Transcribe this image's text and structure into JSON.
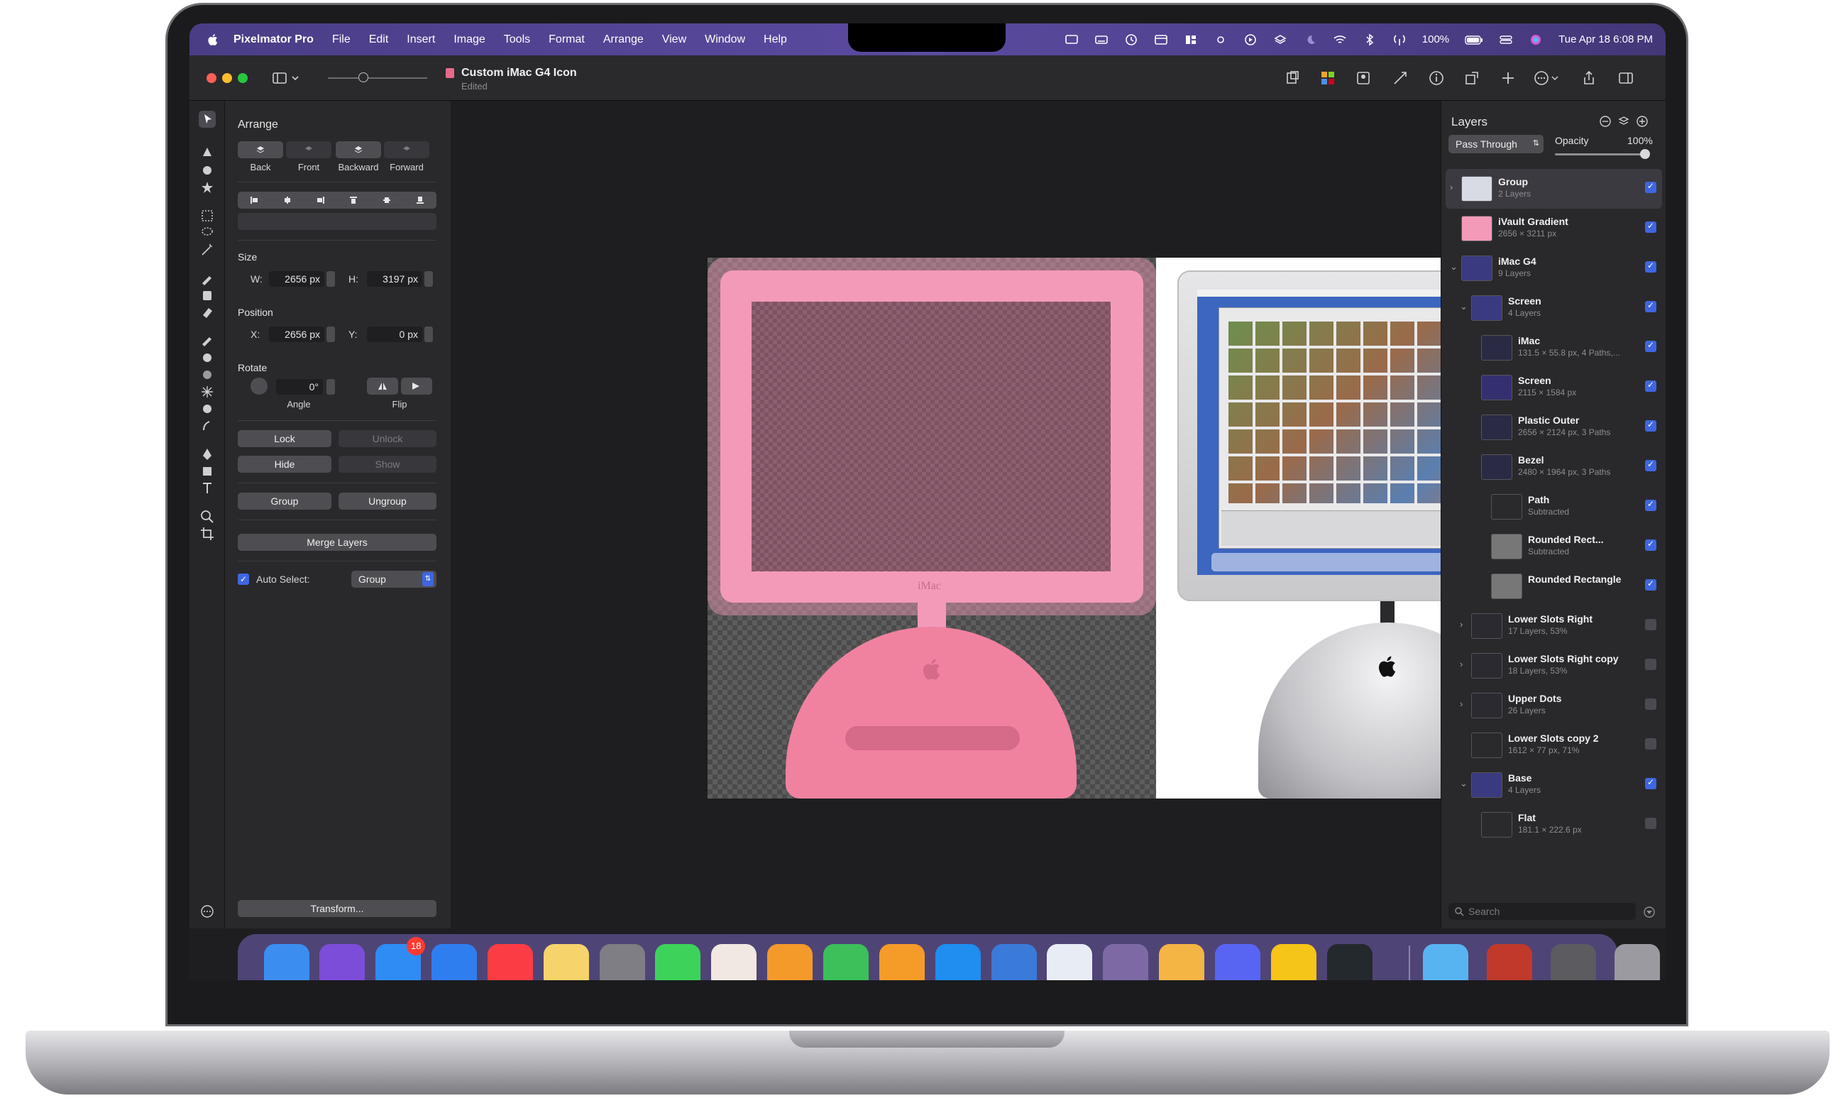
{
  "menubar": {
    "app_name": "Pixelmator Pro",
    "items": [
      "File",
      "Edit",
      "Insert",
      "Image",
      "Tools",
      "Format",
      "Arrange",
      "View",
      "Window",
      "Help"
    ],
    "battery": "100%",
    "datetime": "Tue Apr 18  6:08 PM"
  },
  "document": {
    "title": "Custom iMac G4 Icon",
    "subtitle": "Edited"
  },
  "arrange_panel": {
    "title": "Arrange",
    "order_buttons": [
      "Back",
      "Front",
      "Backward",
      "Forward"
    ],
    "size_title": "Size",
    "width_label": "W:",
    "width_value": "2656 px",
    "height_label": "H:",
    "height_value": "3197 px",
    "position_title": "Position",
    "x_label": "X:",
    "x_value": "2656 px",
    "y_label": "Y:",
    "y_value": "0 px",
    "rotate_title": "Rotate",
    "angle_value": "0°",
    "angle_label": "Angle",
    "flip_label": "Flip",
    "lock_label": "Lock",
    "unlock_label": "Unlock",
    "hide_label": "Hide",
    "show_label": "Show",
    "group_label": "Group",
    "ungroup_label": "Ungroup",
    "merge_label": "Merge Layers",
    "auto_select_label": "Auto Select:",
    "auto_select_value": "Group",
    "transform_label": "Transform..."
  },
  "layers_panel": {
    "title": "Layers",
    "blend_mode": "Pass Through",
    "opacity_label": "Opacity",
    "opacity_value": "100%",
    "search_placeholder": "Search",
    "rows": [
      {
        "name": "Group",
        "meta": "2 Layers",
        "checked": true,
        "indent": 0,
        "selected": true
      },
      {
        "name": "iVault Gradient",
        "meta": "2656 × 3211 px",
        "checked": true,
        "indent": 0,
        "selected": false
      },
      {
        "name": "iMac G4",
        "meta": "9 Layers",
        "checked": true,
        "indent": 0,
        "selected": false
      },
      {
        "name": "Screen",
        "meta": "4 Layers",
        "checked": true,
        "indent": 1,
        "selected": false
      },
      {
        "name": "iMac",
        "meta": "131.5 × 55.8 px, 4 Paths,...",
        "checked": true,
        "indent": 2,
        "selected": false
      },
      {
        "name": "Screen",
        "meta": "2115 × 1584 px",
        "checked": true,
        "indent": 2,
        "selected": false
      },
      {
        "name": "Plastic Outer",
        "meta": "2656 × 2124 px, 3 Paths",
        "checked": true,
        "indent": 2,
        "selected": false
      },
      {
        "name": "Bezel",
        "meta": "2480 × 1964 px, 3 Paths",
        "checked": true,
        "indent": 2,
        "selected": false
      },
      {
        "name": "Path",
        "meta": "Subtracted",
        "checked": true,
        "indent": 3,
        "selected": false
      },
      {
        "name": "Rounded Rect...",
        "meta": "Subtracted",
        "checked": true,
        "indent": 3,
        "selected": false
      },
      {
        "name": "Rounded Rectangle",
        "meta": "",
        "checked": true,
        "indent": 3,
        "selected": false
      },
      {
        "name": "Lower Slots Right",
        "meta": "17 Layers, 53%",
        "checked": false,
        "indent": 1,
        "selected": false
      },
      {
        "name": "Lower Slots Right copy",
        "meta": "18 Layers, 53%",
        "checked": false,
        "indent": 1,
        "selected": false
      },
      {
        "name": "Upper Dots",
        "meta": "26 Layers",
        "checked": false,
        "indent": 1,
        "selected": false
      },
      {
        "name": "Lower Slots copy 2",
        "meta": "1612 × 77 px, 71%",
        "checked": false,
        "indent": 1,
        "selected": false
      },
      {
        "name": "Base",
        "meta": "4 Layers",
        "checked": true,
        "indent": 1,
        "selected": false
      },
      {
        "name": "Flat",
        "meta": "181.1 × 222.6 px",
        "checked": false,
        "indent": 2,
        "selected": false
      }
    ]
  },
  "canvas": {
    "left_label": "iMac"
  },
  "dock": {
    "mail_badge": "18",
    "apps": [
      "finder-icon",
      "siri-icon",
      "mail-icon",
      "safari-icon",
      "music-icon",
      "notes-icon",
      "system-settings-icon",
      "messages-icon",
      "photos-icon",
      "pages-icon",
      "find-my-icon",
      "home-icon",
      "app-store-icon",
      "xcode-icon",
      "textedit-icon",
      "archive-icon",
      "pixelmator-icon",
      "discord-icon",
      "tes-icon",
      "github-icon",
      "folder-icon",
      "books-icon",
      "screenshot-icon",
      "trash-icon"
    ]
  },
  "colors": {
    "accent": "#3f66e0",
    "menubar": "#5b4aa0",
    "pink_imac": "#f39ab9"
  }
}
